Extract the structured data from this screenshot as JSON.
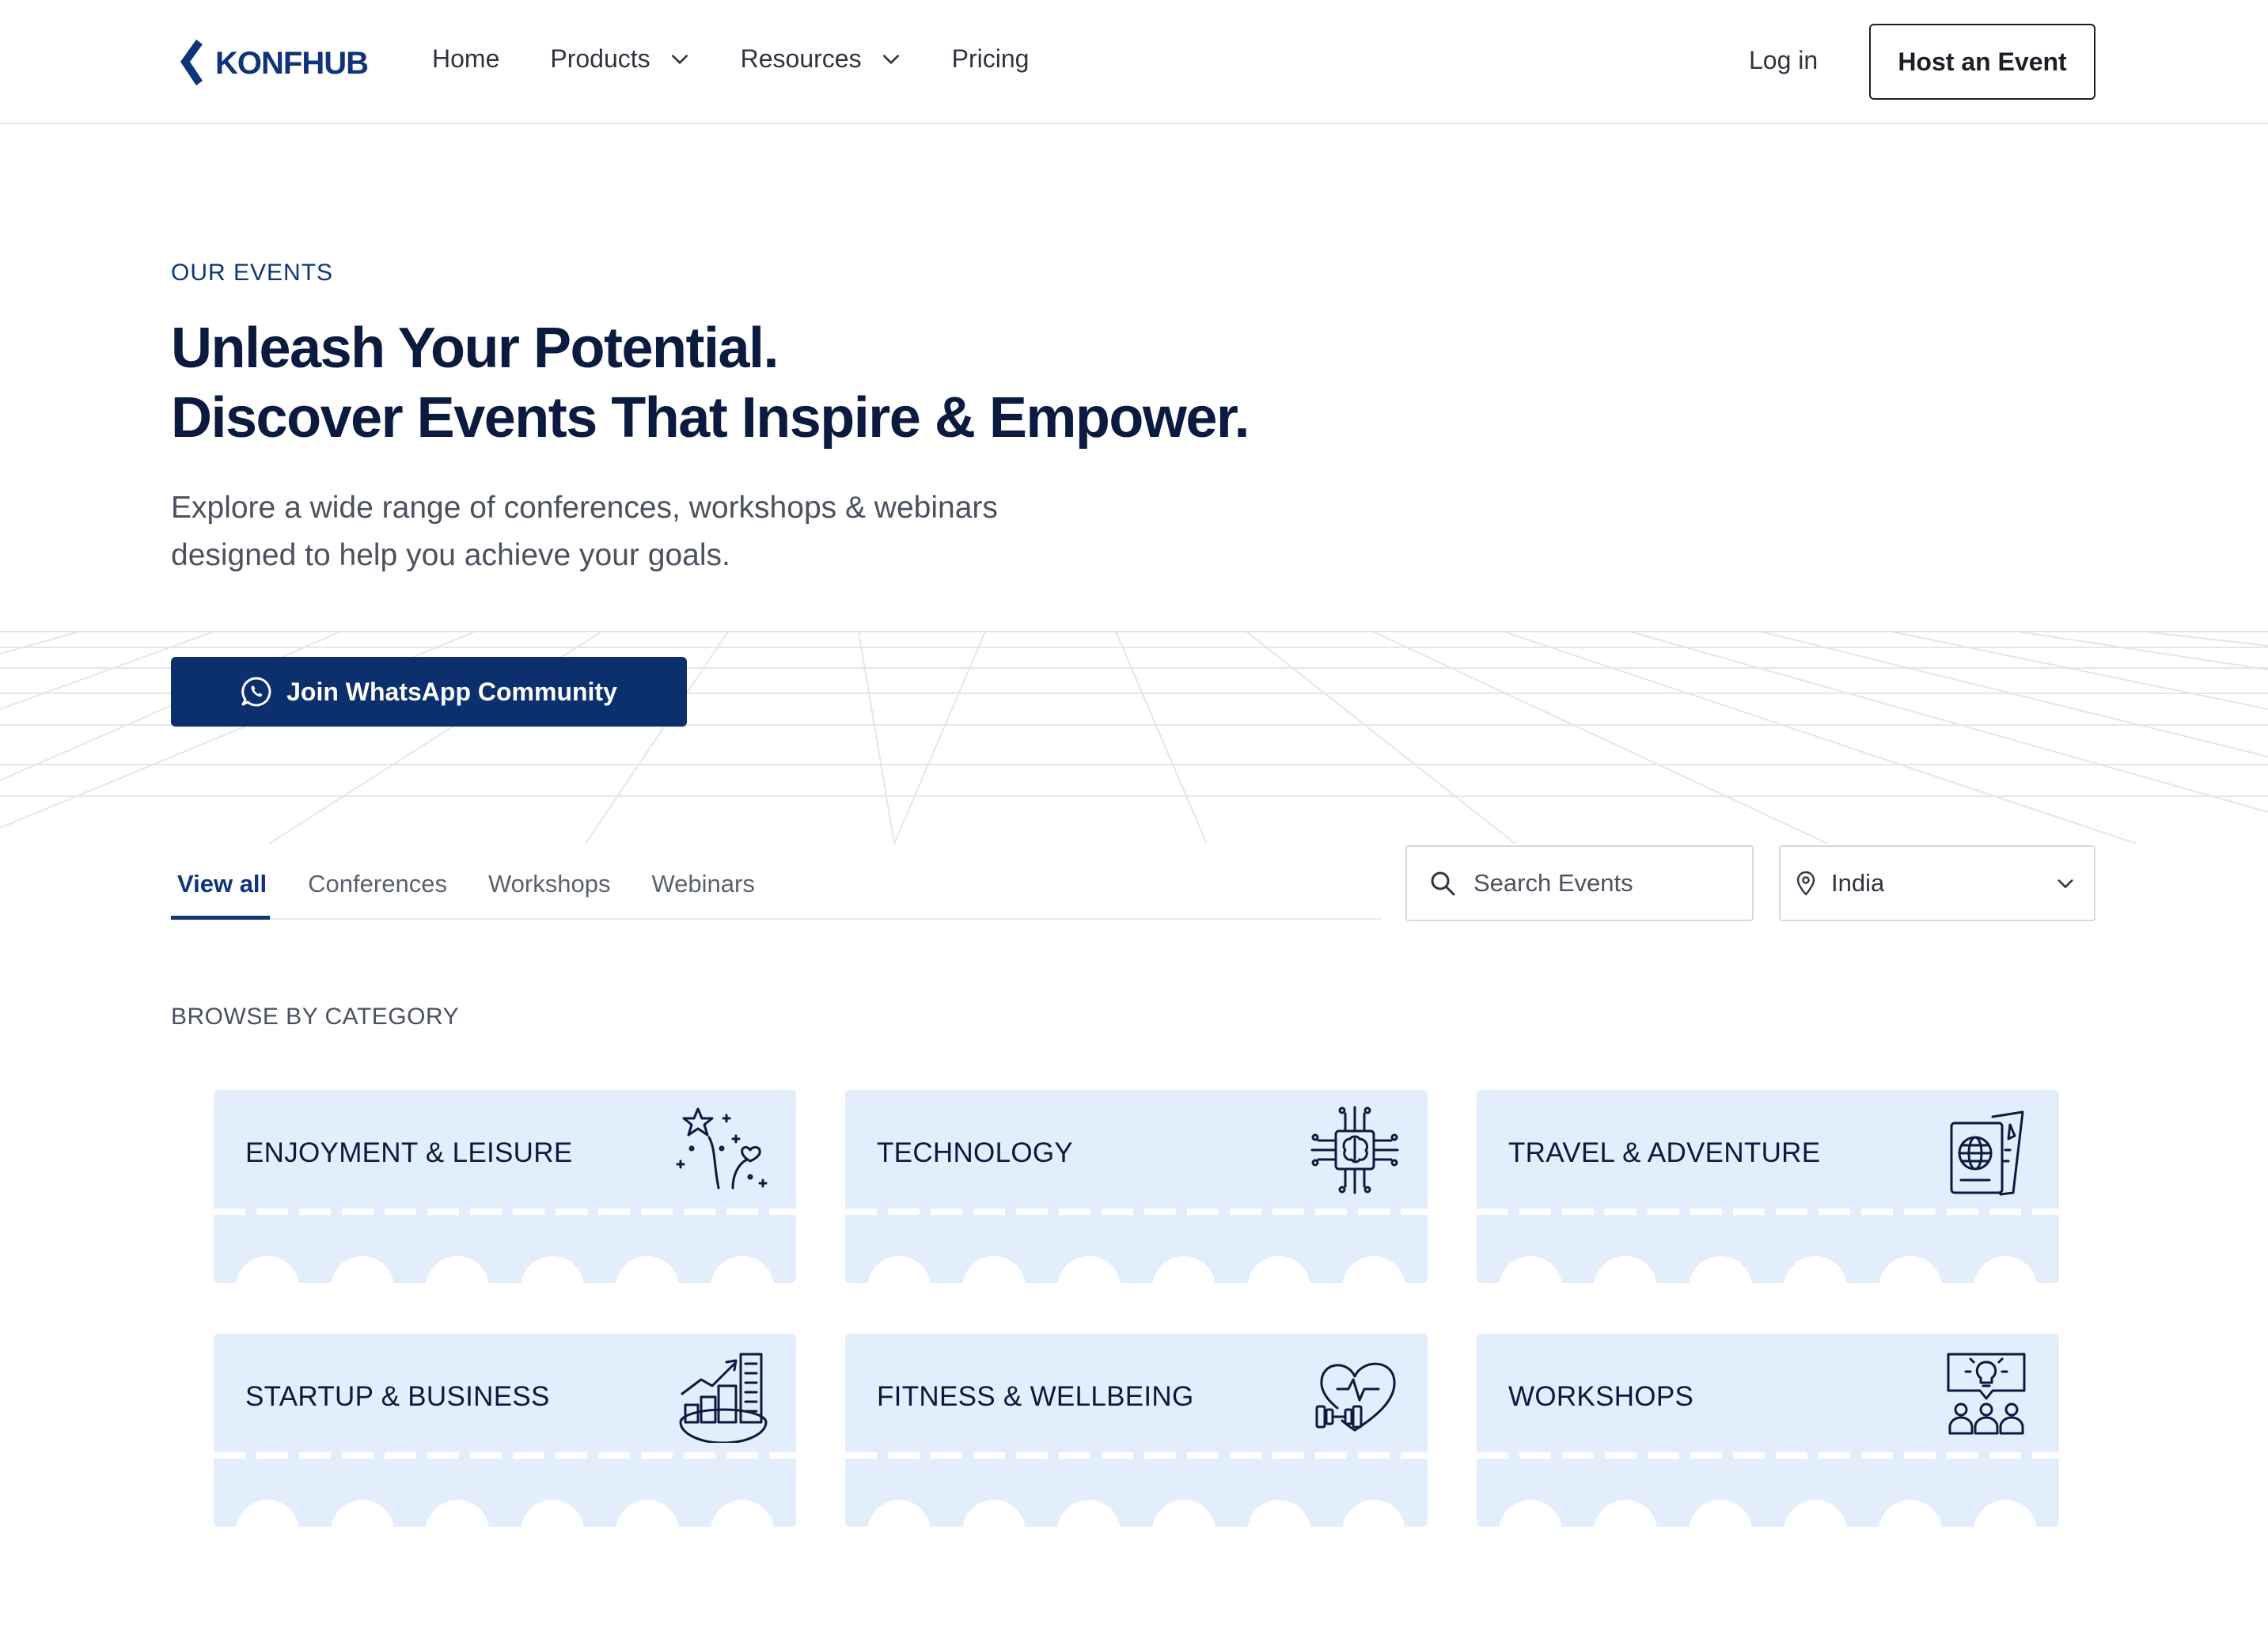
{
  "brand": {
    "name": "KONFHUB",
    "accent": "#0c2f6e",
    "card_bg": "#e2eefc"
  },
  "nav": {
    "items": [
      {
        "label": "Home",
        "has_dropdown": false
      },
      {
        "label": "Products",
        "has_dropdown": true
      },
      {
        "label": "Resources",
        "has_dropdown": true
      },
      {
        "label": "Pricing",
        "has_dropdown": false
      }
    ],
    "login": "Log in",
    "cta": "Host an Event"
  },
  "hero": {
    "eyebrow": "OUR EVENTS",
    "title_line1": "Unleash Your Potential.",
    "title_line2": "Discover Events That Inspire & Empower.",
    "subtitle_line1": "Explore a wide range of conferences, workshops & webinars",
    "subtitle_line2": "designed to help you achieve your goals.",
    "whatsapp_button": "Join WhatsApp Community",
    "whatsapp_icon": "whatsapp-icon"
  },
  "filters": {
    "tabs": [
      {
        "label": "View all",
        "active": true
      },
      {
        "label": "Conferences",
        "active": false
      },
      {
        "label": "Workshops",
        "active": false
      },
      {
        "label": "Webinars",
        "active": false
      }
    ],
    "search_placeholder": "Search Events",
    "location": "India"
  },
  "categories": {
    "heading": "BROWSE BY CATEGORY",
    "items": [
      {
        "label": "ENJOYMENT & LEISURE",
        "icon": "fireworks-icon"
      },
      {
        "label": "TECHNOLOGY",
        "icon": "chip-brain-icon"
      },
      {
        "label": "TRAVEL & ADVENTURE",
        "icon": "passport-icon"
      },
      {
        "label": "STARTUP & BUSINESS",
        "icon": "city-growth-icon"
      },
      {
        "label": "FITNESS & WELLBEING",
        "icon": "heart-dumbbell-icon"
      },
      {
        "label": "WORKSHOPS",
        "icon": "idea-group-icon"
      }
    ]
  }
}
